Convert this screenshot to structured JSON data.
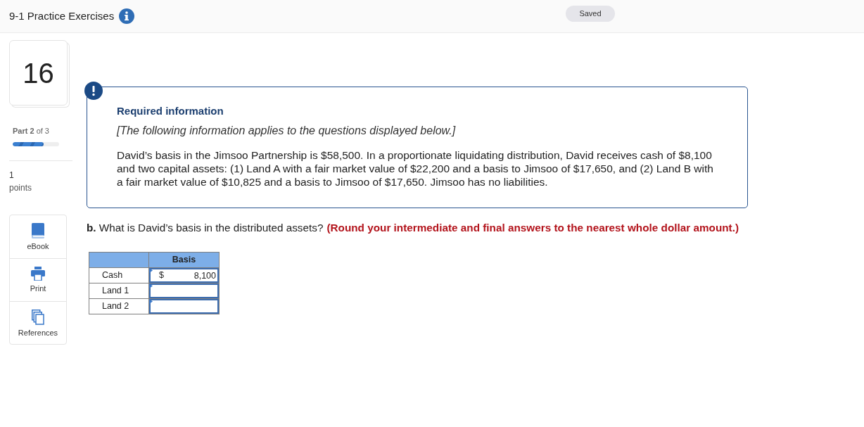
{
  "header": {
    "title": "9-1 Practice Exercises",
    "status": "Saved"
  },
  "sidebar": {
    "question_number": "16",
    "part": {
      "label": "**Part 2** of 3",
      "level": 0.67
    },
    "points": {
      "value": "1",
      "label": "points"
    },
    "tools": [
      {
        "kind": "book",
        "label": "eBook"
      },
      {
        "kind": "print",
        "label": "Print"
      },
      {
        "kind": "references",
        "label": "References"
      }
    ]
  },
  "required_info": {
    "heading": "Required information",
    "note": "[The following information applies to the questions displayed below.]",
    "body": "David’s basis in the Jimsoo Partnership is $58,500. In a proportionate liquidating distribution, David receives cash of $8,100 and two capital assets: (1) Land A with a fair market value of $22,200 and a basis to Jimsoo of $17,650, and (2) Land B with a fair market value of $10,825 and a basis to Jimsoo of $17,650. Jimsoo has no liabilities."
  },
  "question": {
    "text": "**b.** What is David’s basis in the distributed assets?",
    "instruction": "(Round your intermediate and final answers to the nearest whole dollar amount.)"
  },
  "table": {
    "column_2": "Basis",
    "rows": [
      {
        "label": "Cash",
        "currency": "$",
        "value": "8,100"
      },
      {
        "label": "Land 1"
      },
      {
        "label": "Land 2"
      }
    ]
  }
}
